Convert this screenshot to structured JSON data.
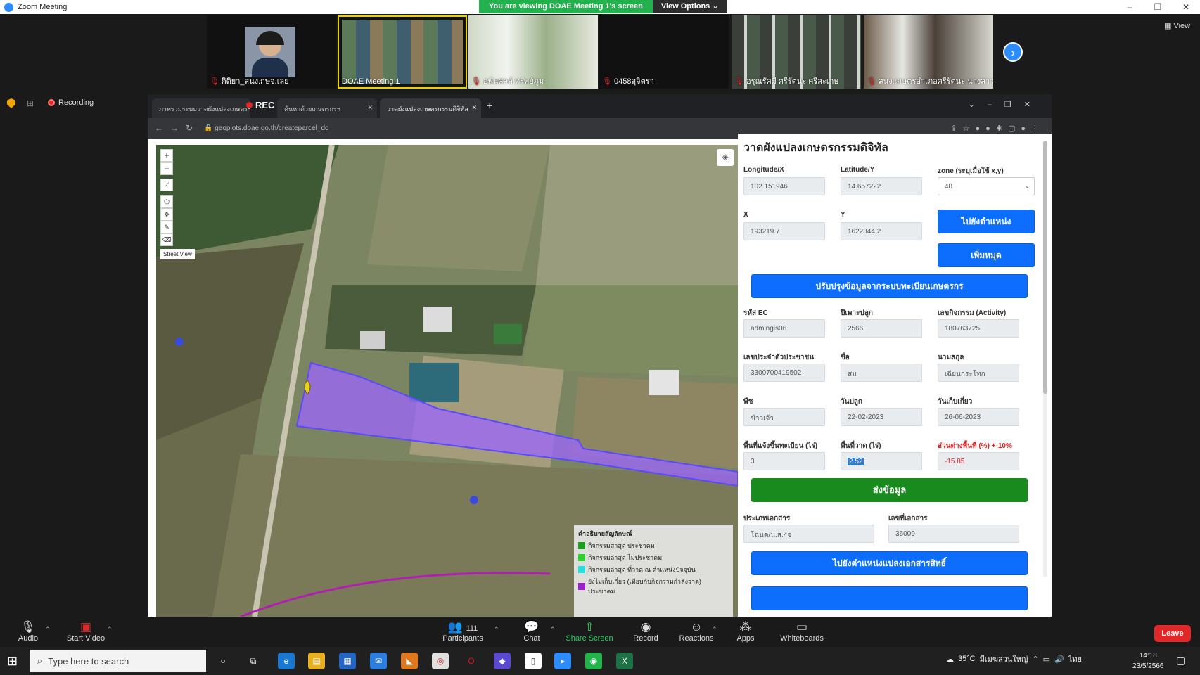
{
  "window": {
    "title": "Zoom Meeting",
    "view_label": "View"
  },
  "banner": {
    "message": "You are viewing DOAE Meeting 1's screen",
    "options_label": "View Options"
  },
  "gallery": [
    {
      "name": "กิติยา_สนง.กษจ.เลย"
    },
    {
      "name": "DOAE Meeting 1"
    },
    {
      "name": "อพันศลล์ ทรัพย์ภูม"
    },
    {
      "name": "0458สุจิตรา"
    },
    {
      "name": "อรุณรัศมี ศรีรัตนะ ศรีสะเกษ"
    },
    {
      "name": "สนง.เกษตรอำเภอศรีรัตนะ นางสาวส..."
    }
  ],
  "recording_label": "Recording",
  "browser": {
    "rec_label": "REC",
    "tabs": [
      "ภาพรวมระบบวาดผังแปลงเกษตรฯ",
      "ค้นหาด้วยเกษตรกรฯ",
      "วาดผังแปลงเกษตรกรรมดิจิทัล"
    ],
    "url": "geoplots.doae.go.th/createparcel_dc"
  },
  "map": {
    "street_view": "Street View",
    "legend": {
      "title": "คำอธิบายสัญลักษณ์",
      "items": [
        {
          "label": "กิจกรรมสาสุด ประชาคม",
          "color": "#1aa01a"
        },
        {
          "label": "กิจกรรมล่าสุด ไม่ประชาคม",
          "color": "#2fd12f"
        },
        {
          "label": "กิจกรรมล่าสุด ที่วาด ณ ตำแหน่งปัจจุบัน",
          "color": "#22e0e0"
        },
        {
          "label": "ยังไม่เก็บเกี่ยว (เทียบกับกิจกรรมกำลังวาด) ประชาคม",
          "color": "#9b1fd1"
        }
      ]
    }
  },
  "form": {
    "title": "วาดผังแปลงเกษตรกรรมดิจิทัล",
    "longitude_label": "Longitude/X",
    "longitude_value": "102.151946",
    "latitude_label": "Latitude/Y",
    "latitude_value": "14.657222",
    "zone_label": "zone (ระบุเมื่อใช้ x,y)",
    "zone_value": "48",
    "x_label": "X",
    "x_value": "193219.7",
    "y_label": "Y",
    "y_value": "1622344.2",
    "goto_button": "ไปยังตำแหน่ง",
    "add_pin_button": "เพิ่มหมุด",
    "update_button": "ปรับปรุงข้อมูลจากระบบทะเบียนเกษตรกร",
    "ec_label": "รหัส EC",
    "ec_value": "admingis06",
    "year_label": "ปีเพาะปลูก",
    "year_value": "2566",
    "activity_label": "เลขกิจกรรม (Activity)",
    "activity_value": "180763725",
    "citizen_label": "เลขประจำตัวประชาชน",
    "citizen_value": "3300700419502",
    "firstname_label": "ชื่อ",
    "firstname_value": "สม",
    "lastname_label": "นามสกุล",
    "lastname_value": "เฉียนกระโทก",
    "crop_label": "พืช",
    "crop_value": "ข้าวเจ้า",
    "plant_date_label": "วันปลูก",
    "plant_date_value": "22-02-2023",
    "harvest_label": "วันเก็บเกี่ยว",
    "harvest_value": "26-06-2023",
    "reg_area_label": "พื้นที่แจ้งขึ้นทะเบียน (ไร่)",
    "reg_area_value": "3",
    "drawn_area_label": "พื้นที่วาด (ไร่)",
    "drawn_area_value": "2.52",
    "diff_label": "ส่วนต่างพื้นที่ (%) +-10%",
    "diff_value": "-15.85",
    "submit_button": "ส่งข้อมูล",
    "doc_type_label": "ประเภทเอกสาร",
    "doc_type_value": "โฉนด/น.ส.4จ",
    "doc_no_label": "เลขที่เอกสาร",
    "doc_no_value": "36009",
    "goto_doc_button": "ไปยังตำแหน่งแปลงเอกสารสิทธิ์"
  },
  "toolbar": {
    "audio": "Audio",
    "video": "Start Video",
    "participants": "Participants",
    "participants_count": "111",
    "chat": "Chat",
    "share": "Share Screen",
    "record": "Record",
    "reactions": "Reactions",
    "apps": "Apps",
    "whiteboards": "Whiteboards",
    "leave": "Leave"
  },
  "taskbar": {
    "search_placeholder": "Type here to search",
    "weather": "35°C",
    "weather_text": "มีเมฆส่วนใหญ่",
    "language": "ไทย",
    "time": "14:18",
    "date": "23/5/2566"
  }
}
